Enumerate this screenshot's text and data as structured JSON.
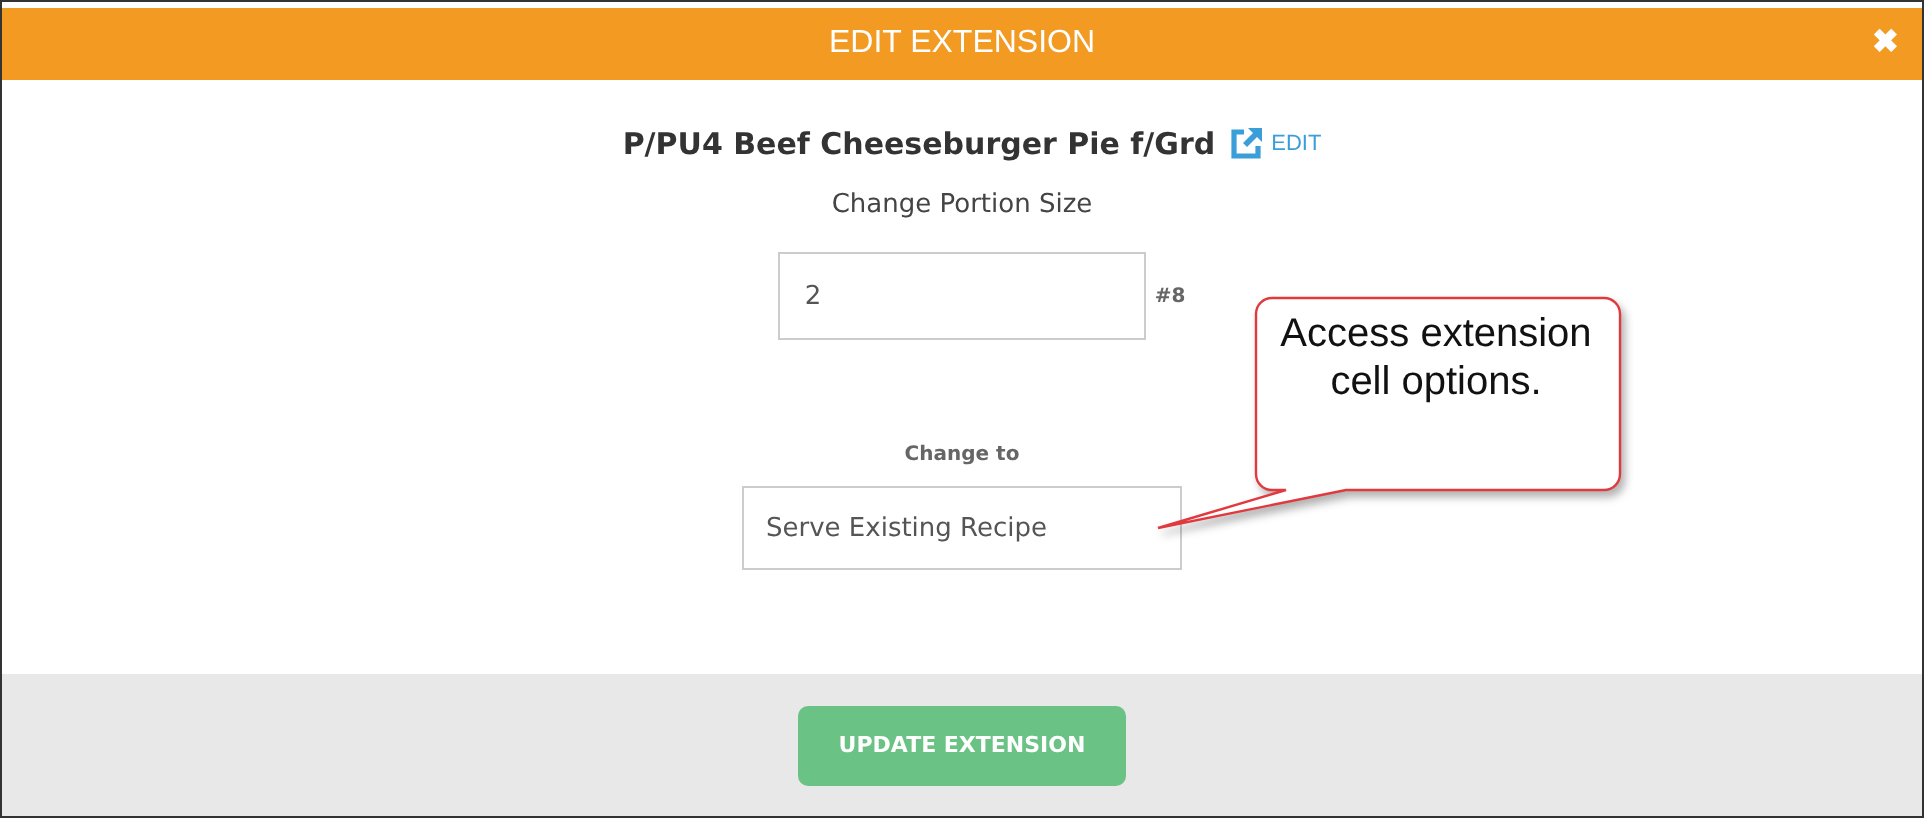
{
  "dialog": {
    "title": "EDIT EXTENSION",
    "close": "✖"
  },
  "item": {
    "name": "P/PU4 Beef Cheeseburger Pie f/Grd",
    "edit_link": "EDIT"
  },
  "portion": {
    "label": "Change Portion Size",
    "value": "2",
    "unit": "#8"
  },
  "change_to": {
    "label": "Change to",
    "value": "Serve Existing Recipe"
  },
  "callout": {
    "text": "Access extension cell options."
  },
  "footer": {
    "button": "UPDATE EXTENSION"
  }
}
